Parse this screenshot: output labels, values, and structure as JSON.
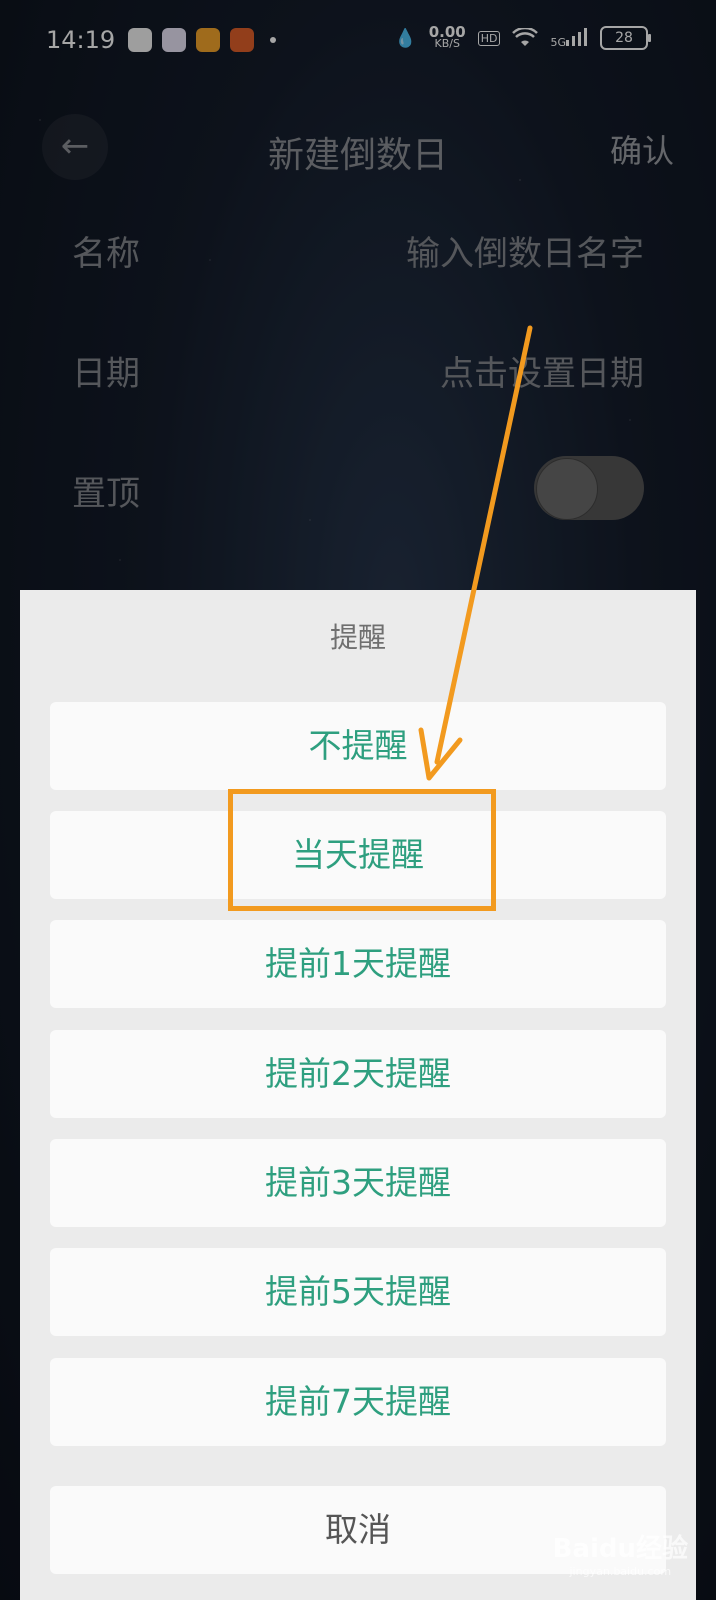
{
  "status_bar": {
    "time": "14:19",
    "net_speed": "0.00",
    "net_unit": "KB/S",
    "hd": "HD",
    "signal_label": "5G",
    "battery": "28"
  },
  "header": {
    "title": "新建倒数日",
    "confirm_label": "确认"
  },
  "form": {
    "name_label": "名称",
    "name_placeholder": "输入倒数日名字",
    "date_label": "日期",
    "date_value": "点击设置日期",
    "pin_label": "置顶",
    "pin_on": false
  },
  "reminder_sheet": {
    "title": "提醒",
    "options": [
      "不提醒",
      "当天提醒",
      "提前1天提醒",
      "提前2天提醒",
      "提前3天提醒",
      "提前5天提醒",
      "提前7天提醒"
    ],
    "cancel_label": "取消"
  },
  "annotation": {
    "color": "#f29a1f"
  },
  "watermark": {
    "logo": "Baidu经验",
    "sub": "jingyan.baidu.com"
  },
  "colors": {
    "option_text": "#2e9f7f",
    "sheet_bg": "#ebebeb"
  }
}
